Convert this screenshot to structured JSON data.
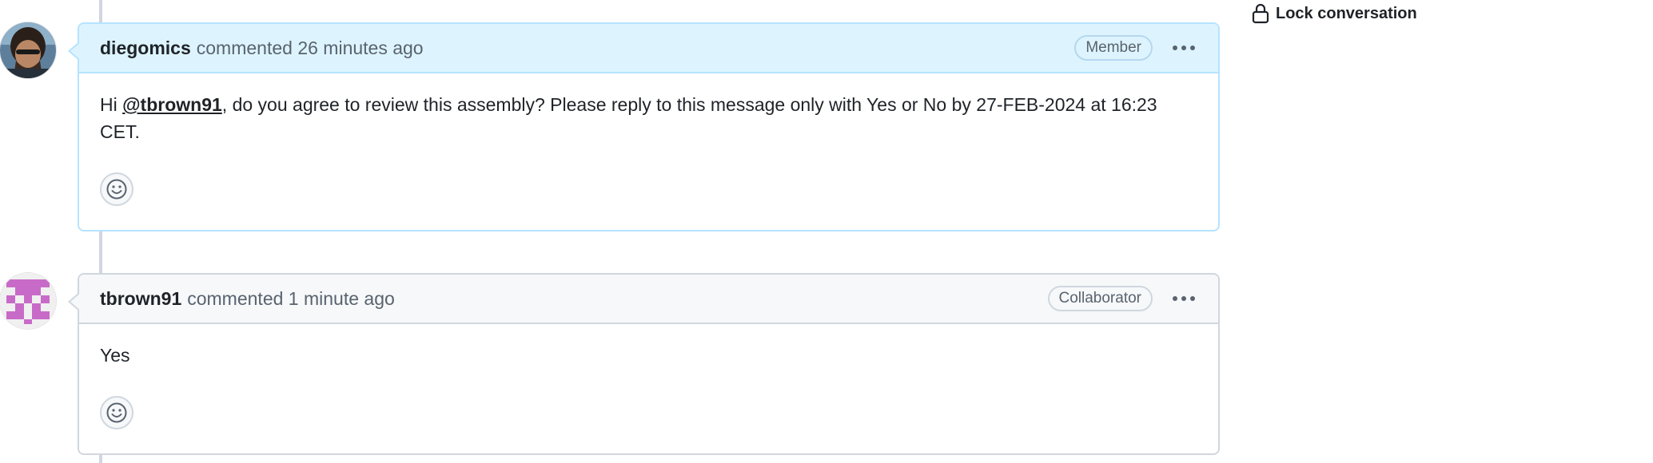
{
  "sidebar": {
    "lock_label": "Lock conversation",
    "lock_icon": "lock-icon"
  },
  "comments": [
    {
      "author": "diegomics",
      "action": "commented",
      "time": "26 minutes ago",
      "role": "Member",
      "body_prefix": "Hi ",
      "mention": "@tbrown91",
      "body_suffix": ", do you agree to review this assembly? Please reply to this message only with Yes or No by 27-FEB-2024 at 16:23 CET.",
      "header_bg": "#ddf4ff",
      "border_color": "#b6e3ff"
    },
    {
      "author": "tbrown91",
      "action": "commented",
      "time": "1 minute ago",
      "role": "Collaborator",
      "body": "Yes",
      "header_bg": "#f6f8fa",
      "border_color": "#d0d7de"
    }
  ],
  "icons": {
    "menu": "kebab-horizontal-icon",
    "reaction": "smiley-icon"
  }
}
